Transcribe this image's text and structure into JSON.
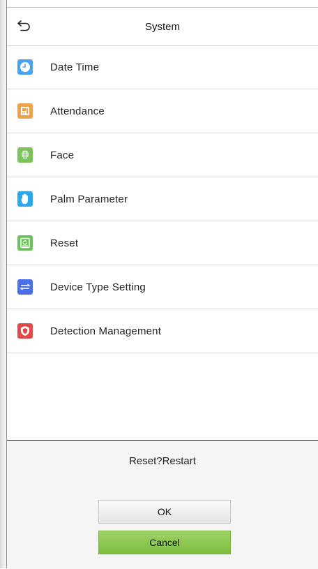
{
  "header": {
    "title": "System",
    "back_icon": "back-arrow-icon"
  },
  "menu": {
    "items": [
      {
        "label": "Date Time",
        "icon": "clock-icon",
        "color": "#4aa3f0"
      },
      {
        "label": "Attendance",
        "icon": "attendance-terminal-icon",
        "color": "#f0a24a"
      },
      {
        "label": "Face",
        "icon": "face-icon",
        "color": "#7ac35a"
      },
      {
        "label": "Palm Parameter",
        "icon": "palm-icon",
        "color": "#2aa8e8"
      },
      {
        "label": "Reset",
        "icon": "reset-icon",
        "color": "#6cc05a"
      },
      {
        "label": "Device Type Setting",
        "icon": "switch-arrows-icon",
        "color": "#4b6fe8"
      },
      {
        "label": "Detection Management",
        "icon": "shield-icon",
        "color": "#e24a4a"
      }
    ]
  },
  "dialog": {
    "message": "Reset?Restart",
    "ok_label": "OK",
    "cancel_label": "Cancel"
  }
}
